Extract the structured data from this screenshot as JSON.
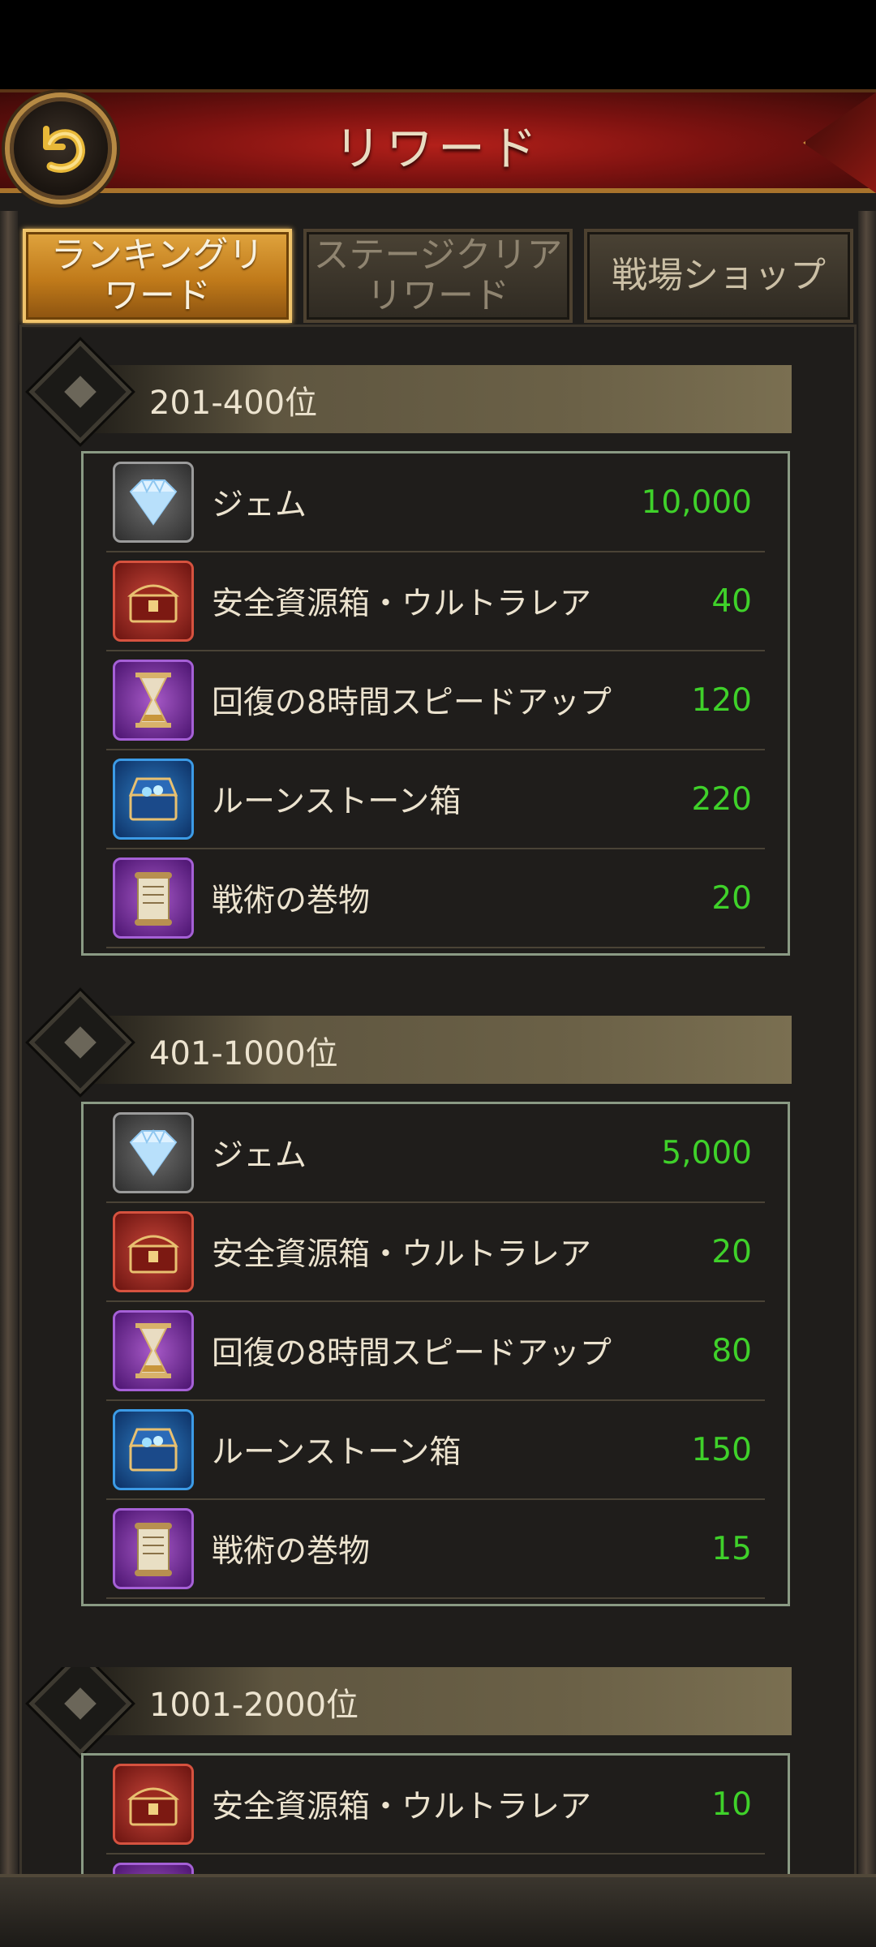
{
  "header": {
    "title": "リワード",
    "back_icon": "back-arrow-icon"
  },
  "tabs": [
    {
      "label": "ランキングリワード",
      "active": true
    },
    {
      "label": "ステージクリアリワード",
      "active": false
    },
    {
      "label": "戦場ショップ",
      "active": false
    }
  ],
  "sections": [
    {
      "title": "201-400位",
      "items": [
        {
          "icon": "gem-icon",
          "name": "ジェム",
          "qty": "10,000"
        },
        {
          "icon": "chest-icon",
          "name": "安全資源箱・ウルトラレア",
          "qty": "40"
        },
        {
          "icon": "hourglass-icon",
          "name": "回復の8時間スピードアップ",
          "qty": "120"
        },
        {
          "icon": "rune-chest-icon",
          "name": "ルーンストーン箱",
          "qty": "220"
        },
        {
          "icon": "scroll-icon",
          "name": "戦術の巻物",
          "qty": "20"
        }
      ]
    },
    {
      "title": "401-1000位",
      "items": [
        {
          "icon": "gem-icon",
          "name": "ジェム",
          "qty": "5,000"
        },
        {
          "icon": "chest-icon",
          "name": "安全資源箱・ウルトラレア",
          "qty": "20"
        },
        {
          "icon": "hourglass-icon",
          "name": "回復の8時間スピードアップ",
          "qty": "80"
        },
        {
          "icon": "rune-chest-icon",
          "name": "ルーンストーン箱",
          "qty": "150"
        },
        {
          "icon": "scroll-icon",
          "name": "戦術の巻物",
          "qty": "15"
        }
      ]
    },
    {
      "title": "1001-2000位",
      "items": [
        {
          "icon": "chest-icon",
          "name": "安全資源箱・ウルトラレア",
          "qty": "10"
        }
      ]
    }
  ],
  "colors": {
    "quantity": "#3fd12a",
    "active_tab": "#c07a1a",
    "header": "#8d1913"
  }
}
